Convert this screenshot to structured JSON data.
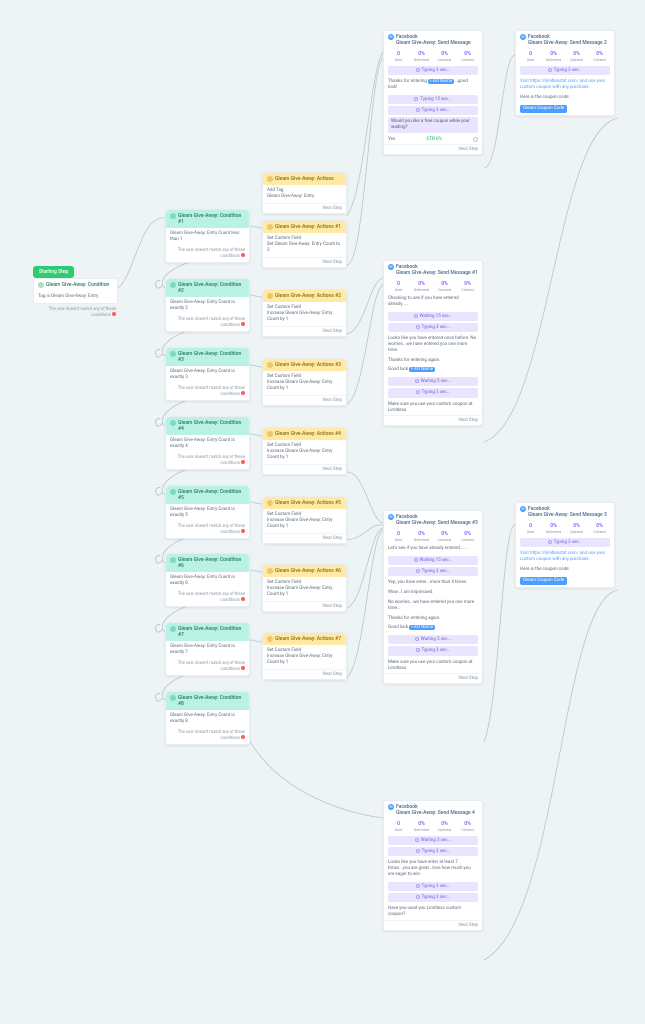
{
  "start": {
    "badge": "Starting Step",
    "head": "Gleam Give-Away: Condition",
    "body": "Tag is Gleam Give-Away: Entry",
    "fail": "The user doesn't match any of these conditions"
  },
  "conditions": [
    {
      "head": "Gleam Give-Away: Condition #1",
      "body": "Gleam Give-Away: Entry Count less than 1",
      "fail": "The user doesn't match any of these conditions"
    },
    {
      "head": "Gleam Give-Away: Condition #2",
      "body": "Gleam Give-Away: Entry Count is exactly 2",
      "fail": "The user doesn't match any of these conditions"
    },
    {
      "head": "Gleam Give-Away: Condition #3",
      "body": "Gleam Give-Away: Entry Count is exactly 3",
      "fail": "The user doesn't match any of these conditions"
    },
    {
      "head": "Gleam Give-Away: Condition #4",
      "body": "Gleam Give-Away: Entry Count is exactly 4",
      "fail": "The user doesn't match any of these conditions"
    },
    {
      "head": "Gleam Give-Away: Condition #5",
      "body": "Gleam Give-Away: Entry Count is exactly 5",
      "fail": "The user doesn't match any of these conditions"
    },
    {
      "head": "Gleam Give-Away: Condition #6",
      "body": "Gleam Give-Away: Entry Count is exactly 6",
      "fail": "The user doesn't match any of these conditions"
    },
    {
      "head": "Gleam Give-Away: Condition #7",
      "body": "Gleam Give-Away: Entry Count is exactly 7",
      "fail": "The user doesn't match any of these conditions"
    },
    {
      "head": "Gleam Give-Away: Condition #8",
      "body": "Gleam Give-Away: Entry Count is exactly 8",
      "fail": "The user doesn't match any of these conditions"
    }
  ],
  "actions": [
    {
      "head": "Gleam Give-Away: Actions",
      "body": "Add Tag\nGleam Give-Away: Entry",
      "foot": "Next Step"
    },
    {
      "head": "Gleam Give-Away: Actions #1",
      "body": "Set Custom Field\nSet Gleam Give-Away: Entry Count to 2",
      "foot": "Next Step"
    },
    {
      "head": "Gleam Give-Away: Actions #2",
      "body": "Set Custom Field\nIncrease Gleam Give-Away: Entry Count by 1",
      "foot": "Next Step"
    },
    {
      "head": "Gleam Give-Away: Actions #3",
      "body": "Set Custom Field\nIncrease Gleam Give-Away: Entry Count by 1",
      "foot": "Next Step"
    },
    {
      "head": "Gleam Give-Away: Actions #4",
      "body": "Set Custom Field\nIncrease Gleam Give-Away: Entry Count by 1",
      "foot": "Next Step"
    },
    {
      "head": "Gleam Give-Away: Actions #5",
      "body": "Set Custom Field\nIncrease Gleam Give-Away: Entry Count by 1",
      "foot": "Next Step"
    },
    {
      "head": "Gleam Give-Away: Actions #6",
      "body": "Set Custom Field\nIncrease Gleam Give-Away: Entry Count by 1",
      "foot": "Next Step"
    },
    {
      "head": "Gleam Give-Away: Actions #7",
      "body": "Set Custom Field\nIncrease Gleam Give-Away: Entry Count by 1",
      "foot": "Next Step"
    }
  ],
  "stat_labels": [
    "Sent",
    "Delivered",
    "Opened",
    "Clicked"
  ],
  "msg1": {
    "head": "Gleam Give-Away: Send Message",
    "stats": [
      "0",
      "0%",
      "0%",
      "0%"
    ],
    "pill1": "Typing 3 sec...",
    "txt1_a": "Thanks for entering ",
    "txt1_tag": "First Name",
    "txt1_b": "...good luck!",
    "pill2": "Typing 15 sec...",
    "pill3": "Typing 3 sec...",
    "alert": "Would you like a free coupon while your waiting?",
    "choice_yes": "Yes",
    "choice_pct": "CTR 0%",
    "foot": "Next Step"
  },
  "msg2": {
    "head": "Gleam Give-Away: Send Message 2",
    "stats": [
      "0",
      "0%",
      "0%",
      "0%"
    ],
    "pill1": "Typing 3 sec...",
    "txt1": "Visit https://limitlesstxt.com/ and use your custom coupon with any purchase.",
    "txt2": "Here is the coupon code:",
    "chip": "Gleam Coupon Code"
  },
  "msg3": {
    "head": "Gleam Give-Away: Send Message #1",
    "stats": [
      "0",
      "0%",
      "0%",
      "0%"
    ],
    "txt1": "Checking to see if you have entered already......",
    "pill1": "Waiting 15 sec...",
    "pill2": "Typing 3 sec...",
    "txt2": "Looks like you have entered once before. No worries...we have entered you one more time.",
    "txt3": "Thanks for entering again.",
    "txt4_a": "Good luck ",
    "txt4_tag": "First Name",
    "pill3": "Waiting 5 sec...",
    "pill4": "Typing 3 sec...",
    "txt5": "Make sure you use your custom coupon at Limitless.",
    "foot": "Next Step"
  },
  "msg4": {
    "head": "Gleam Give-Away: Send Message #3",
    "stats": [
      "0",
      "0%",
      "0%",
      "0%"
    ],
    "txt1": "Let's see if you have already entered......",
    "pill1": "Waiting 15 sec...",
    "pill2": "Typing 3 sec...",
    "txt2": "Yep, you have enter...more than 4 times.",
    "txt3": "Wow...I am impressed.",
    "txt4": "No worries...we have entered you one more time...",
    "txt5": "Thanks for entering again.",
    "txt6_a": "Good luck ",
    "txt6_tag": "First Name",
    "pill3": "Waiting 5 sec...",
    "pill4": "Typing 3 sec...",
    "txt7": "Make sure you use your custom coupon at Limitless.",
    "foot": "Next Step"
  },
  "msg5": {
    "head": "Gleam Give-Away: Send Message 3",
    "stats": [
      "0",
      "0%",
      "0%",
      "0%"
    ],
    "pill1": "Typing 3 sec...",
    "txt1": "Visit https://limitlesstxt.com/ and use your custom coupon with any purchase.",
    "txt2": "Here is the coupon code:",
    "chip": "Gleam Coupon Code"
  },
  "msg6": {
    "head": "Gleam Give-Away: Send Message 4",
    "stats": [
      "0",
      "0%",
      "0%",
      "0%"
    ],
    "pill1": "Waiting 3 sec...",
    "pill2": "Typing 3 sec...",
    "txt1": "Looks like you have enter at least 7 times...you are great...love how much you are eager to win.",
    "pill3": "Typing 3 sec...",
    "pill4": "Typing 3 sec...",
    "txt2": "Have you used you Limitless custom coupon?",
    "foot": "Next Step"
  },
  "fb": "Facebook"
}
